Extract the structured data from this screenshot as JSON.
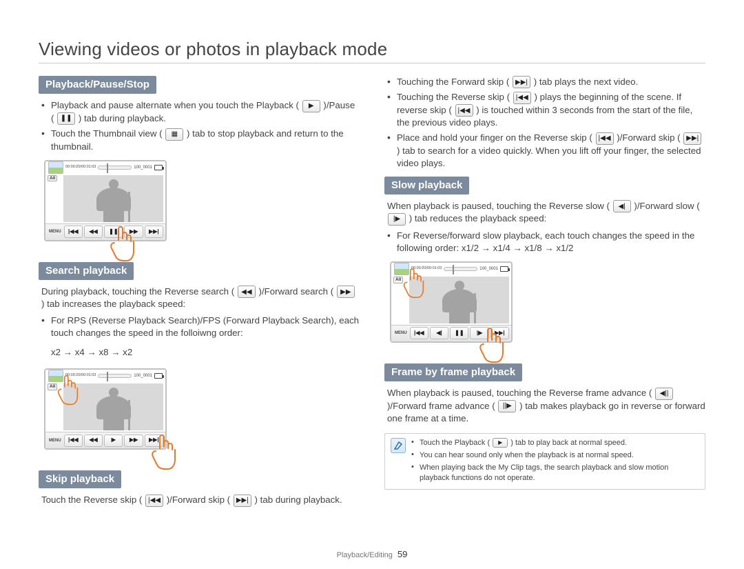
{
  "title": "Viewing videos or photos in playback mode",
  "footer": {
    "section": "Playback/Editing",
    "page": "59"
  },
  "screenshot": {
    "time": "00:00:20/00:01:03",
    "clip": "100_0001",
    "all": "All",
    "menu": "MENU"
  },
  "sec1": {
    "heading": "Playback/Pause/Stop",
    "b1a": "Playback and pause alternate when you touch the Playback (",
    "b1b": ")/Pause (",
    "b1c": ") tab during playback.",
    "b2a": "Touch the Thumbnail view (",
    "b2b": ") tab to stop playback and return to the thumbnail."
  },
  "sec2": {
    "heading": "Search playback",
    "introA": "During playback, touching the Reverse search (",
    "introB": ")/Forward search (",
    "introC": ") tab increases the playback speed:",
    "b1": "For RPS (Reverse Playback Search)/FPS (Forward Playback Search), each touch changes the speed in the folloiwng order:",
    "speed": "x2 → x4 → x8 → x2"
  },
  "sec3": {
    "heading": "Skip playback",
    "introA": "Touch the Reverse skip (",
    "introB": ")/Forward skip (",
    "introC": ") tab during playback."
  },
  "sec4": {
    "b1a": "Touching the Forward skip (",
    "b1b": ") tab plays the next video.",
    "b2a": "Touching the Reverse skip (",
    "b2b": ") plays the beginning of the scene. If reverse skip (",
    "b2c": ") is touched within 3 seconds from the start of the file, the previous video plays.",
    "b3a": "Place and hold your finger on the Reverse skip (",
    "b3b": ")/Forward skip (",
    "b3c": ") tab to search for a video quickly. When you lift off your finger, the selected video plays."
  },
  "sec5": {
    "heading": "Slow playback",
    "introA": "When playback is paused, touching the Reverse slow (",
    "introB": ")/Forward slow (",
    "introC": ") tab reduces the playback speed:",
    "b1": "For Reverse/forward slow playback, each touch changes the speed in the following order: x1/2 → x1/4 → x1/8 → x1/2"
  },
  "sec6": {
    "heading": "Frame by frame playback",
    "introA": "When playback is paused, touching the Reverse frame advance (",
    "introB": ")/Forward frame advance (",
    "introC": ") tab makes playback go in reverse or forward one frame at a time."
  },
  "note": {
    "n1a": "Touch the Playback (",
    "n1b": ") tab to play back at normal speed.",
    "n2": "You can hear sound only when the playback is at normal speed.",
    "n3": "When playing back the My Clip tags, the search playback and slow motion playback functions do not operate."
  }
}
